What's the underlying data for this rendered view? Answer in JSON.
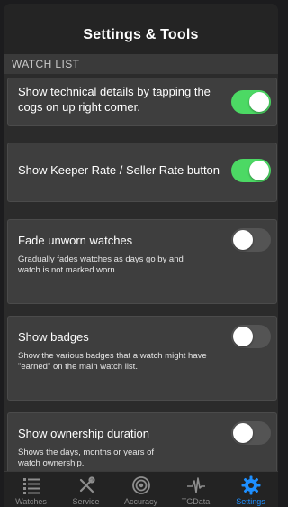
{
  "nav": {
    "title": "Settings & Tools"
  },
  "section": {
    "header": "WATCH LIST"
  },
  "settings": [
    {
      "title": "Show technical details by tapping the cogs on up right corner.",
      "desc": "",
      "on": true
    },
    {
      "title": "Show Keeper Rate / Seller Rate button",
      "desc": "",
      "on": true
    },
    {
      "title": "Fade unworn watches",
      "desc": "Gradually fades watches as days go by and watch is not marked worn.",
      "on": false
    },
    {
      "title": "Show badges",
      "desc": "Show the various badges that a watch might have \"earned\" on the main watch list.",
      "on": false
    },
    {
      "title": "Show ownership duration",
      "desc": "Shows the days, months or years of watch ownership.",
      "on": false
    }
  ],
  "tabs": [
    {
      "label": "Watches",
      "icon": "list-icon",
      "active": false
    },
    {
      "label": "Service",
      "icon": "tools-icon",
      "active": false
    },
    {
      "label": "Accuracy",
      "icon": "target-icon",
      "active": false
    },
    {
      "label": "TGData",
      "icon": "waveform-icon",
      "active": false
    },
    {
      "label": "Settings",
      "icon": "gear-icon",
      "active": true
    }
  ],
  "colors": {
    "accent": "#1e8fff",
    "toggle_on": "#4cd964",
    "toggle_off": "#545454"
  }
}
